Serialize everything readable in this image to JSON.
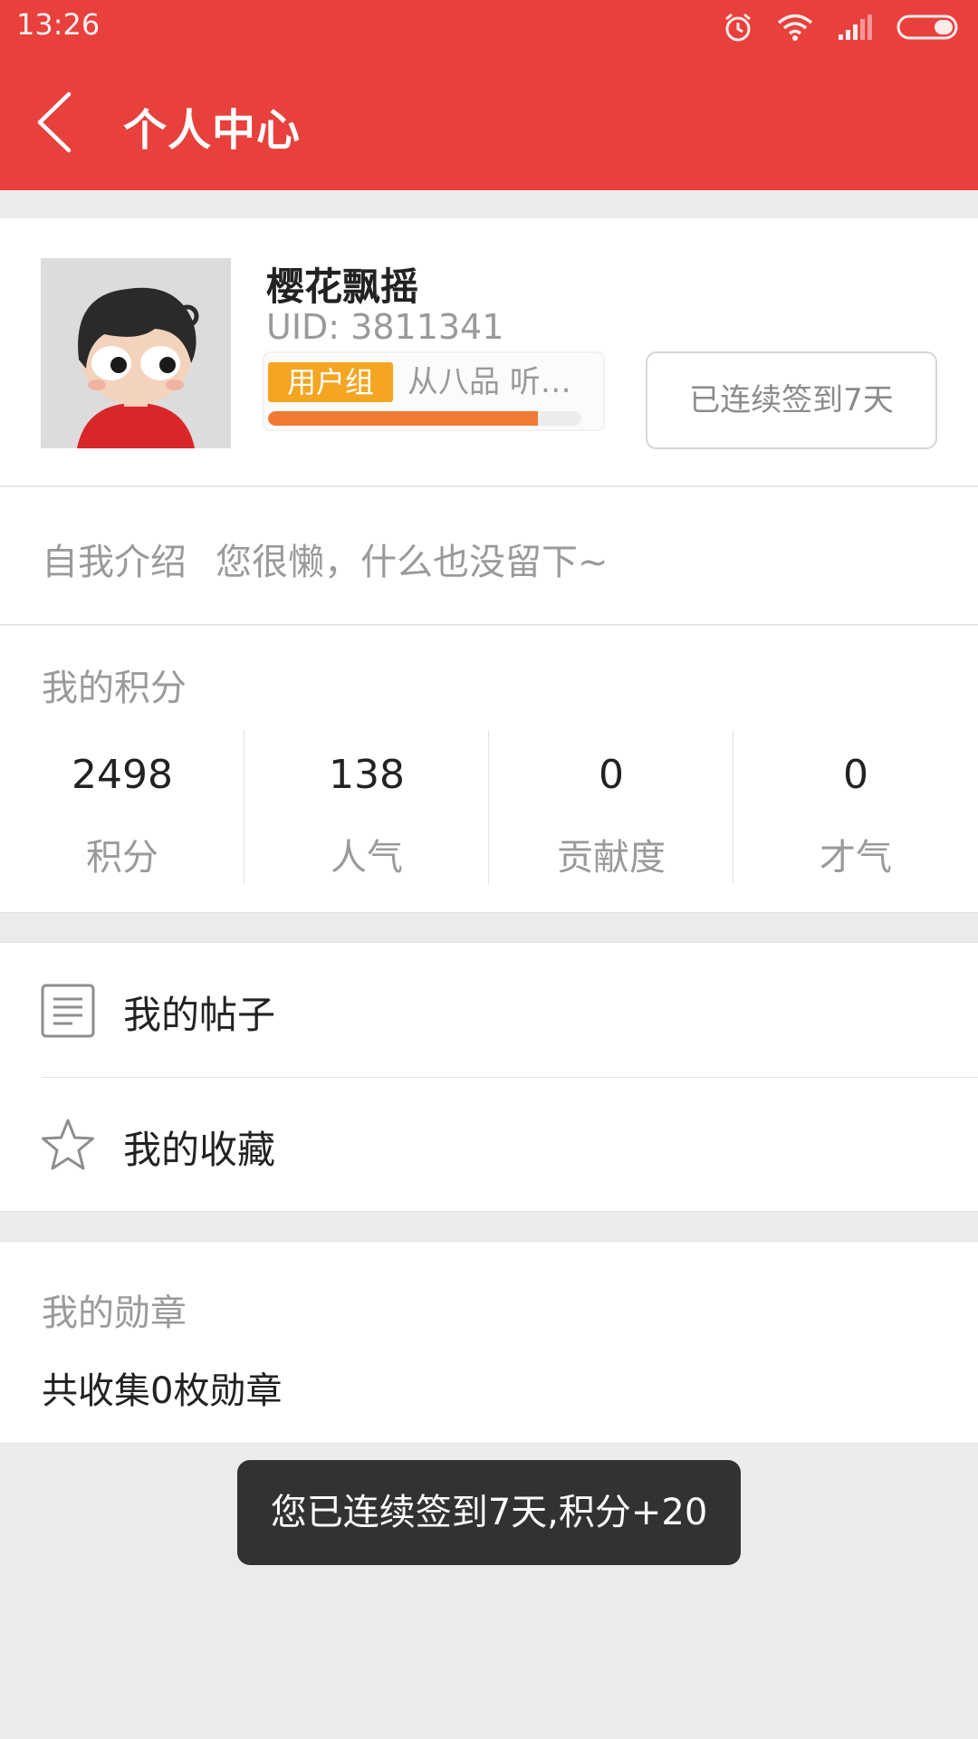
{
  "status_bar": {
    "time": "13:26",
    "icons": [
      "alarm-icon",
      "wifi-icon",
      "signal-icon",
      "battery-icon"
    ]
  },
  "header": {
    "title": "个人中心",
    "background_color": "#e8403c"
  },
  "profile": {
    "username": "樱花飘摇",
    "uid": "UID: 3811341",
    "group_tag": "用户组",
    "group_rank": "从八品  听…",
    "level_progress": 0.86,
    "checkin_button": "已连续签到7天"
  },
  "intro": {
    "label": "自我介绍",
    "text": "您很懒，什么也没留下~"
  },
  "points": {
    "title": "我的积分",
    "stats": [
      {
        "value": "2498",
        "label": "积分"
      },
      {
        "value": "138",
        "label": "人气"
      },
      {
        "value": "0",
        "label": "贡献度"
      },
      {
        "value": "0",
        "label": "才气"
      }
    ]
  },
  "menu": {
    "items": [
      {
        "label": "我的帖子",
        "icon": "document-icon"
      },
      {
        "label": "我的收藏",
        "icon": "star-icon"
      }
    ]
  },
  "medals": {
    "title": "我的勋章",
    "count_text": "共收集0枚勋章"
  },
  "toast": {
    "text": "您已连续签到7天,积分+20"
  }
}
